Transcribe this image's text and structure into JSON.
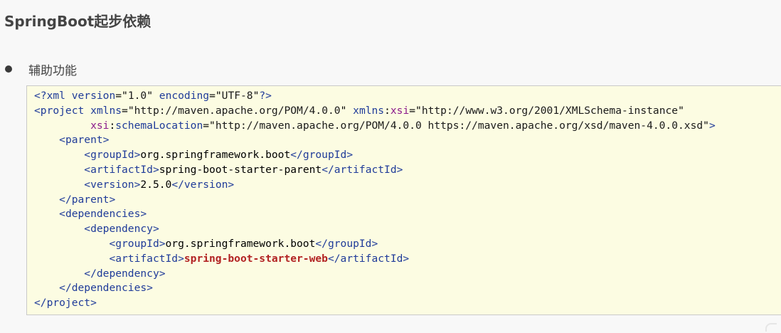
{
  "title": "SpringBoot起步依赖",
  "bullet": "辅助功能",
  "code": {
    "xml_decl_version": "1.0",
    "xml_decl_encoding": "UTF-8",
    "xmlns": "http://maven.apache.org/POM/4.0.0",
    "xmlns_xsi": "http://www.w3.org/2001/XMLSchema-instance",
    "schema_location": "http://maven.apache.org/POM/4.0.0 https://maven.apache.org/xsd/maven-4.0.0.xsd",
    "parent_group_id": "org.springframework.boot",
    "parent_artifact_id": "spring-boot-starter-parent",
    "parent_version": "2.5.0",
    "dep_group_id": "org.springframework.boot",
    "dep_artifact_id": "spring-boot-starter-web"
  },
  "colors": {
    "tag": "#1f3b99",
    "namespace_prefix": "#8b1a8b",
    "highlight_value": "#b22222",
    "code_background": "#fcfce2"
  }
}
